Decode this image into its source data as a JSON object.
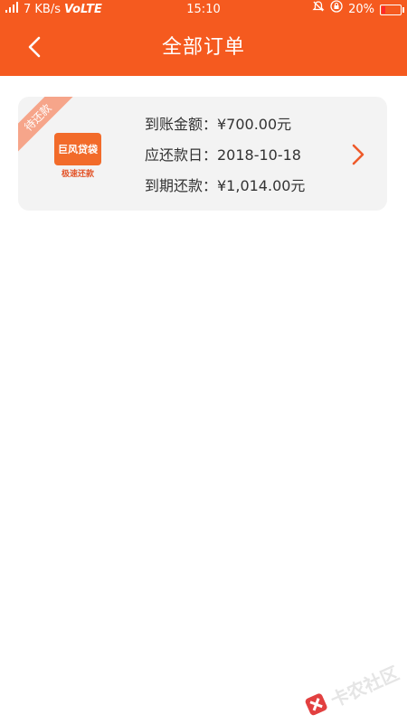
{
  "status_bar": {
    "network_speed": "7 KB/s",
    "volte": "VoLTE",
    "time": "15:10",
    "battery": "20%",
    "battery_level": 0.2
  },
  "header": {
    "title": "全部订单"
  },
  "order": {
    "badge": "待还款",
    "logo_text": "巨风贷袋",
    "logo_sub": "极速还款",
    "received_amount": "到账金额：¥700.00元",
    "due_date": "应还款日：2018-10-18",
    "repay_amount": "到期还款：¥1,014.00元"
  },
  "watermark": {
    "text": "卡农社区"
  },
  "colors": {
    "brand": "#f55a1f",
    "chevron": "#ee5a2a",
    "badge": "#f6a58a"
  }
}
